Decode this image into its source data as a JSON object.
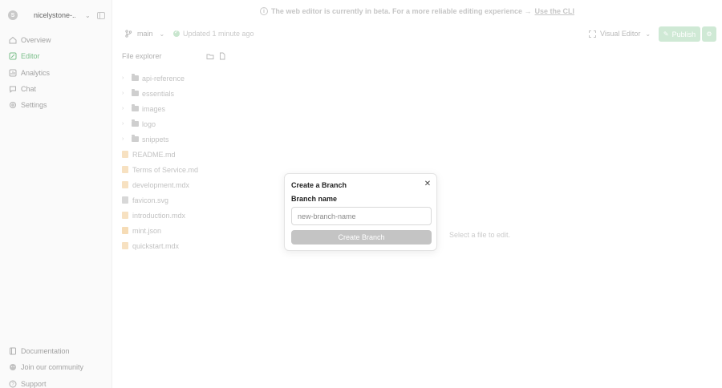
{
  "workspace": {
    "logo_letter": "S",
    "name": "nicelystone-...",
    "icons": {
      "chevron": "chevron-down-icon",
      "toggle": "sidebar-toggle-icon"
    }
  },
  "sidebar": {
    "items": [
      {
        "label": "Overview",
        "icon": "home-icon",
        "active": false
      },
      {
        "label": "Editor",
        "icon": "pencil-icon",
        "active": true
      },
      {
        "label": "Analytics",
        "icon": "chart-icon",
        "active": false
      },
      {
        "label": "Chat",
        "icon": "chat-icon",
        "active": false
      },
      {
        "label": "Settings",
        "icon": "gear-icon",
        "active": false
      }
    ],
    "bottom_items": [
      {
        "label": "Documentation",
        "icon": "book-icon"
      },
      {
        "label": "Join our community",
        "icon": "community-icon"
      },
      {
        "label": "Support",
        "icon": "help-icon"
      }
    ]
  },
  "banner": {
    "icon": "info-icon",
    "text": "The web editor is currently in beta. For a more reliable editing experience →",
    "link": "Use the CLI"
  },
  "toolbar": {
    "branch": "main",
    "updated": "Updated 1 minute ago",
    "visual_editor": "Visual Editor",
    "publish": "Publish"
  },
  "explorer": {
    "title": "File explorer",
    "folders": [
      "api-reference",
      "essentials",
      "images",
      "logo",
      "snippets"
    ],
    "files": [
      {
        "name": "README.md",
        "type": "md"
      },
      {
        "name": "Terms of Service.md",
        "type": "md"
      },
      {
        "name": "development.mdx",
        "type": "md"
      },
      {
        "name": "favicon.svg",
        "type": "svg"
      },
      {
        "name": "introduction.mdx",
        "type": "md"
      },
      {
        "name": "mint.json",
        "type": "json"
      },
      {
        "name": "quickstart.mdx",
        "type": "md"
      }
    ]
  },
  "editor": {
    "empty_text": "Select a file to edit."
  },
  "dialog": {
    "title": "Create a Branch",
    "label": "Branch name",
    "input_value": "",
    "input_placeholder": "new-branch-name",
    "submit": "Create Branch"
  },
  "colors": {
    "accent": "#7bbf8a",
    "publish_bg": "#cfe9d5",
    "button_disabled": "#c4c4c4"
  }
}
